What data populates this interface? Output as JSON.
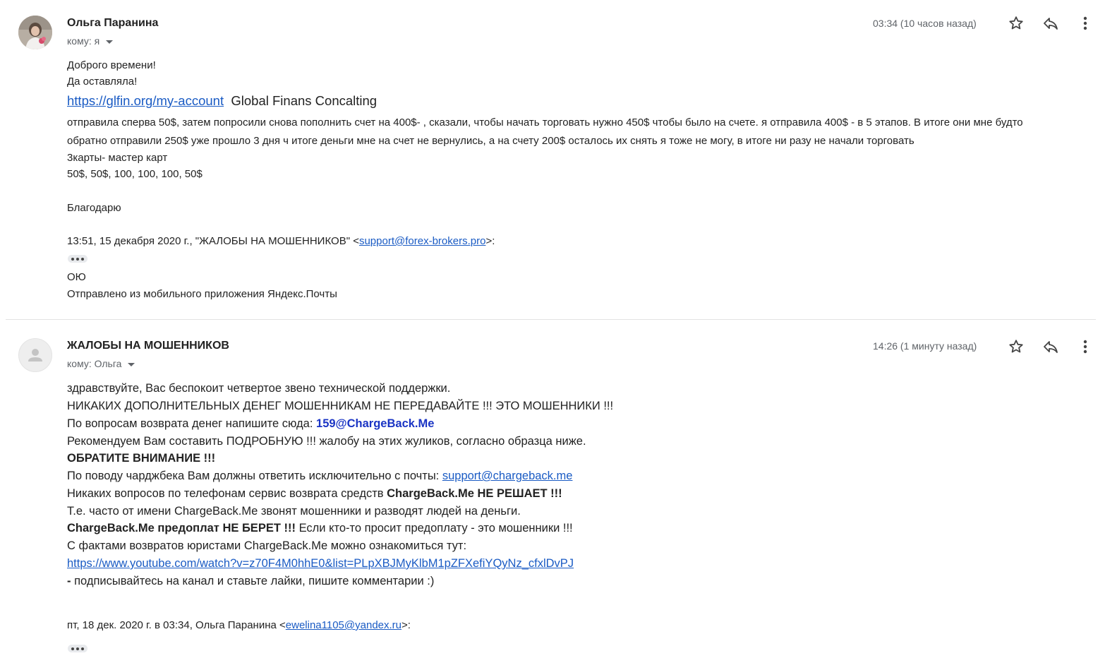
{
  "message1": {
    "sender": "Ольга Паранина",
    "to_label": "кому: я",
    "time": "03:34 (10 часов назад)",
    "avatar_icon": "user-photo-avatar",
    "lines": {
      "l1": "Доброго времени!",
      "l2": "Да оставляла!",
      "link": "https://glfin.org/my-account",
      "company": "Global Finans Concalting",
      "l4a": "отправила сперва 50$, затем попросили снова пополнить счет на 400$- , сказали, чтобы начать торговать нужно 450$ чтобы было на счете. я отправила 400$ - в 5 этапов. В итоге они мне будто",
      "l4b": "обратно отправили 250$ уже прошло 3 дня ч итоге деньги мне на счет не вернулись, а на счету 200$ осталось их снять я тоже не могу, в итоге ни разу не начали торговать",
      "l5": "3карты- мастер карт",
      "l6": "50$, 50$, 100, 100, 100, 50$",
      "l7": "Благодарю",
      "quote_prefix": "13:51, 15 декабря 2020 г., \"ЖАЛОБЫ НА МОШЕННИКОВ\" <",
      "quote_email": "support@forex-brokers.pro",
      "quote_suffix": ">:",
      "sig1": "ОЮ",
      "sig2": "Отправлено из мобильного приложения Яндекс.Почты"
    }
  },
  "message2": {
    "sender": "ЖАЛОБЫ НА МОШЕННИКОВ",
    "to_label": "кому: Ольга",
    "time": "14:26 (1 минуту назад)",
    "avatar_icon": "default-person-avatar",
    "lines": {
      "l1": "здравствуйте, Вас беспокоит четвертое звено технической поддержки.",
      "l2": "НИКАКИХ ДОПОЛНИТЕЛЬНЫХ ДЕНЕГ МОШЕННИКАМ НЕ ПЕРЕДАВАЙТЕ !!! ЭТО МОШЕННИКИ !!!",
      "l3a": "По вопросам возврата денег напишите сюда: ",
      "l3b": "159@ChargeBack.Me",
      "l4": "Рекомендуем Вам составить ПОДРОБНУЮ !!! жалобу на этих жуликов, согласно образца ниже.",
      "l5": "ОБРАТИТЕ ВНИМАНИЕ !!!",
      "l6a": "По поводу чарджбека Вам должны ответить исключительно с почты: ",
      "l6b": "support@chargeback.me",
      "l7a": "Никаких вопросов по телефонам сервис возврата средств ",
      "l7b": "ChargeBack.Me НЕ РЕШАЕТ !!!",
      "l8": "Т.е. часто от имени ChargeBack.Me звонят мошенники и разводят людей на деньги.",
      "l9a": "ChargeBack.Me предоплат НЕ БЕРЕТ !!!",
      "l9b": " Если кто-то просит предоплату - это мошенники !!!",
      "l10": "С фактами возвратов юристами ChargeBack.Me можно ознакомиться тут:",
      "l11": "https://www.youtube.com/watch?v=z70F4M0hhE0&list=PLpXBJMyKlbM1pZFXefiYQyNz_cfxlDvPJ",
      "l12a": " - ",
      "l12b": "подписывайтесь на канал и ставьте лайки, пишите комментарии :)",
      "quote_prefix": "пт, 18 дек. 2020 г. в 03:34, Ольга Паранина <",
      "quote_email": "ewelina1105@yandex.ru",
      "quote_suffix": ">:"
    }
  },
  "icons": {
    "star": "star-icon",
    "reply": "reply-icon",
    "more": "more-vert-icon",
    "dropdown": "caret-down-icon",
    "expand": "ellipsis-icon"
  },
  "colors": {
    "link": "#1a5bc4",
    "secondary_text": "#5f6368",
    "emphasis_link": "#1a34c4"
  }
}
